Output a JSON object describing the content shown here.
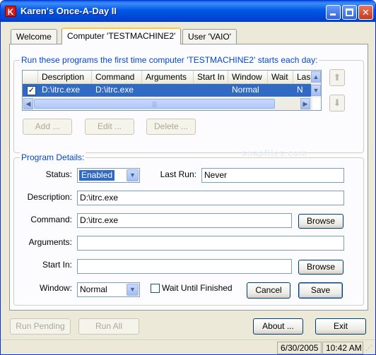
{
  "window": {
    "title": "Karen's Once-A-Day II",
    "icon_letter": "K",
    "controls": {
      "minimize": "minimize-icon",
      "maximize": "maximize-icon",
      "close": "close-icon"
    }
  },
  "tabs": [
    {
      "label": "Welcome"
    },
    {
      "label": "Computer 'TESTMACHINE2'"
    },
    {
      "label": "User 'VAIO'"
    }
  ],
  "programs_group": {
    "title": "Run these programs the first time computer 'TESTMACHINE2' starts each day:",
    "columns": [
      "Description",
      "Command",
      "Arguments",
      "Start In",
      "Window",
      "Wait",
      "Las"
    ],
    "rows": [
      {
        "checked": "✓",
        "description": "D:\\itrc.exe",
        "command": "D:\\itrc.exe",
        "arguments": "",
        "start_in": "",
        "window": "Normal",
        "wait": "",
        "last": "N"
      }
    ],
    "buttons": {
      "add": "Add ...",
      "edit": "Edit ...",
      "delete": "Delete ..."
    },
    "move_up_icon": "arrow-up-icon",
    "move_down_icon": "arrow-down-icon"
  },
  "details": {
    "title": "Program Details:",
    "status_label": "Status:",
    "status_value": "Enabled",
    "last_run_label": "Last Run:",
    "last_run_value": "Never",
    "description_label": "Description:",
    "description_value": "D:\\itrc.exe",
    "command_label": "Command:",
    "command_value": "D:\\itrc.exe",
    "arguments_label": "Arguments:",
    "arguments_value": "",
    "start_in_label": "Start In:",
    "start_in_value": "",
    "browse_label": "Browse",
    "window_label": "Window:",
    "window_value": "Normal",
    "wait_label": "Wait Until Finished",
    "cancel_label": "Cancel",
    "save_label": "Save"
  },
  "watermark": "snapfiles.com",
  "bottom": {
    "run_pending": "Run Pending",
    "run_all": "Run All",
    "about": "About ...",
    "exit": "Exit"
  },
  "statusbar": {
    "date": "6/30/2005",
    "time": "10:42 AM"
  }
}
